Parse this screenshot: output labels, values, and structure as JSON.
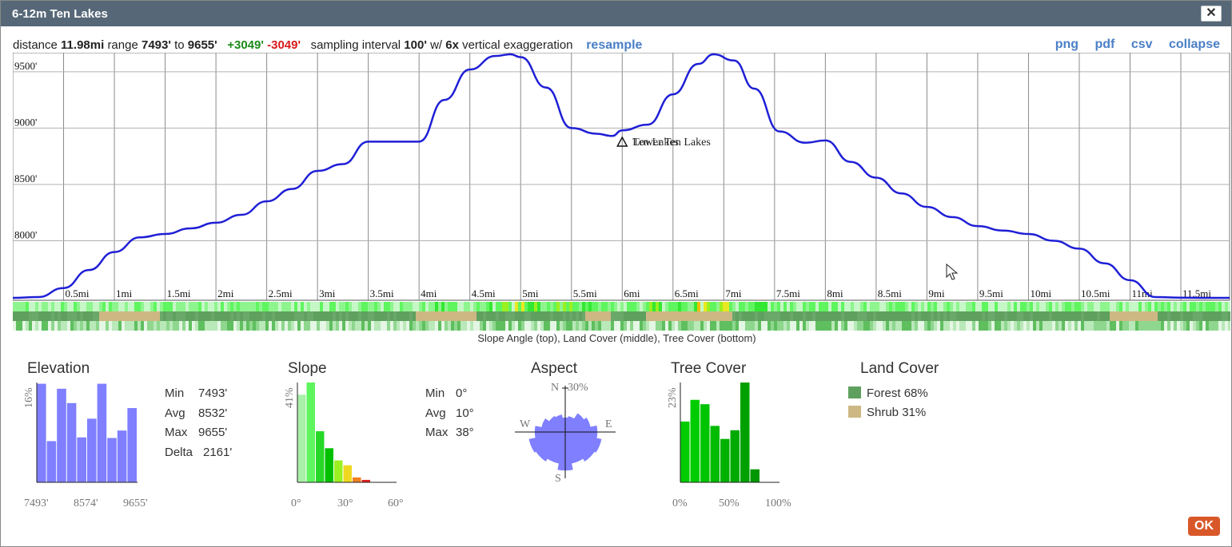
{
  "dialog": {
    "title": "6-12m Ten Lakes",
    "close_glyph": "✕",
    "ok_label": "OK"
  },
  "stats": {
    "distance_label": "distance",
    "distance": "11.98mi",
    "range_label": "range",
    "range_min": "7493'",
    "to_label": "to",
    "range_max": "9655'",
    "gain": "+3049'",
    "loss": "-3049'",
    "interval_label": "sampling interval",
    "interval": "100'",
    "with_label": "w/",
    "exaggeration": "6x",
    "exaggeration_label": "vertical exaggeration",
    "resample_label": "resample"
  },
  "export_links": {
    "png": "png",
    "pdf": "pdf",
    "csv": "csv",
    "collapse": "collapse"
  },
  "chart_data": [
    {
      "type": "line",
      "xlabel": "",
      "ylabel": "",
      "xunit": "mi",
      "xlim": [
        0,
        11.98
      ],
      "ylim": [
        7493,
        9655
      ],
      "x_ticks": [
        "0.5mi",
        "1mi",
        "1.5mi",
        "2mi",
        "2.5mi",
        "3mi",
        "3.5mi",
        "4mi",
        "4.5mi",
        "5mi",
        "5.5mi",
        "6mi",
        "6.5mi",
        "7mi",
        "7.5mi",
        "8mi",
        "8.5mi",
        "9mi",
        "9.5mi",
        "10mi",
        "10.5mi",
        "11mi",
        "11.5mi"
      ],
      "y_ticks": [
        "8000'",
        "8500'",
        "9000'",
        "9500'"
      ],
      "y_tick_values": [
        8000,
        8500,
        9000,
        9500
      ],
      "series": [
        {
          "color": "#1f1fd6",
          "x": [
            0,
            0.25,
            0.5,
            0.75,
            1.0,
            1.25,
            1.5,
            1.75,
            2.0,
            2.25,
            2.5,
            2.75,
            3.0,
            3.25,
            3.5,
            3.75,
            4.0,
            4.25,
            4.5,
            4.75,
            4.9,
            5.0,
            5.25,
            5.5,
            5.75,
            5.9,
            6.0,
            6.25,
            6.5,
            6.75,
            6.9,
            7.1,
            7.3,
            7.55,
            7.8,
            8.0,
            8.25,
            8.5,
            8.75,
            9.0,
            9.25,
            9.5,
            9.75,
            10.0,
            10.25,
            10.5,
            10.75,
            11.0,
            11.25,
            11.5,
            11.75,
            11.98
          ],
          "y": [
            7493,
            7500,
            7580,
            7740,
            7900,
            8030,
            8060,
            8110,
            8160,
            8230,
            8350,
            8460,
            8620,
            8680,
            8880,
            8880,
            8880,
            9250,
            9520,
            9640,
            9655,
            9630,
            9360,
            9000,
            8950,
            8930,
            8980,
            9030,
            9300,
            9570,
            9655,
            9600,
            9350,
            8970,
            8870,
            8890,
            8700,
            8560,
            8420,
            8300,
            8210,
            8130,
            8090,
            8060,
            8000,
            7930,
            7800,
            7650,
            7500,
            7495,
            7493,
            7493
          ]
        }
      ],
      "markers": [
        {
          "symbol": "triangle",
          "x": 6.0,
          "labels": [
            "Lower Ten Lakes",
            "Ten Lakes"
          ]
        }
      ]
    },
    {
      "type": "bar",
      "title": "Elevation",
      "ymax_label": "16%",
      "x_labels": [
        "7493'",
        "8574'",
        "9655'"
      ],
      "values": [
        15.8,
        6.6,
        15.0,
        12.7,
        7.2,
        10.2,
        15.8,
        7.1,
        8.3,
        11.9
      ],
      "color": "#7f7fff"
    },
    {
      "type": "bar",
      "title": "Slope",
      "ymax_label": "41%",
      "x_labels": [
        "0°",
        "30°",
        "60°"
      ],
      "values": [
        36,
        41,
        21,
        14,
        9,
        7,
        2,
        1
      ],
      "colors": [
        "#a9f0a9",
        "#5ff55f",
        "#28d828",
        "#00c000",
        "#9af020",
        "#f0d820",
        "#f08020",
        "#e02020"
      ]
    },
    {
      "type": "pie",
      "title": "Aspect",
      "scale_label": "30%",
      "compass": {
        "n": "N",
        "s": "S",
        "e": "E",
        "w": "W"
      },
      "directions": [
        "N",
        "NNE",
        "NE",
        "ENE",
        "E",
        "ESE",
        "SE",
        "SSE",
        "S",
        "SSW",
        "SW",
        "WSW",
        "W",
        "WNW",
        "NW",
        "NNW"
      ],
      "values": [
        9,
        10,
        14,
        16,
        20,
        23,
        22,
        20,
        24,
        20,
        22,
        23,
        19,
        15,
        12,
        11
      ],
      "color": "#7f7fff"
    },
    {
      "type": "bar",
      "title": "Tree Cover",
      "ymax_label": "23%",
      "x_labels": [
        "0%",
        "50%",
        "100%"
      ],
      "values": [
        14,
        19,
        18,
        13,
        10,
        12,
        23,
        3
      ],
      "colors": [
        "#00cc00",
        "#00cc00",
        "#00c400",
        "#00bb00",
        "#00b200",
        "#00aa00",
        "#00a000",
        "#009600"
      ]
    }
  ],
  "legend": {
    "caption": "Slope Angle (top), Land Cover (middle), Tree Cover (bottom)"
  },
  "slope_stats": {
    "min_label": "Min",
    "min": "0°",
    "avg_label": "Avg",
    "avg": "10°",
    "max_label": "Max",
    "max": "38°"
  },
  "elevation_stats": {
    "min_label": "Min",
    "min": "7493'",
    "avg_label": "Avg",
    "avg": "8532'",
    "max_label": "Max",
    "max": "9655'",
    "delta_label": "Delta",
    "delta": "2161'"
  },
  "land_cover": {
    "title": "Land Cover",
    "items": [
      {
        "label": "Forest",
        "value": "68%",
        "color": "#5fa05f"
      },
      {
        "label": "Shrub",
        "value": "31%",
        "color": "#cdb884"
      }
    ]
  }
}
